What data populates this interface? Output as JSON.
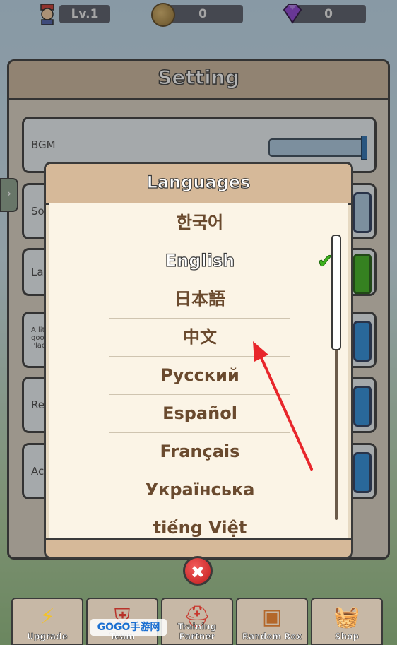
{
  "topbar": {
    "level": "Lv.1",
    "coins": "0",
    "gems": "0"
  },
  "settings": {
    "title": "Setting",
    "rows": [
      {
        "label": "BGM"
      },
      {
        "label": "So"
      },
      {
        "label": "La"
      },
      {
        "label": "A lit goo Plac"
      },
      {
        "label": "Re"
      },
      {
        "label": "Ac"
      }
    ]
  },
  "languages": {
    "title": "Languages",
    "selected": "English",
    "items": [
      "한국어",
      "English",
      "日本語",
      "中文",
      "Русский",
      "Español",
      "Français",
      "Українська",
      "tiếng Việt"
    ]
  },
  "close_button": {
    "icon": "close-icon",
    "label": "✖"
  },
  "bottom_nav": [
    {
      "label": "Upgrade",
      "icon": "lightning-icon"
    },
    {
      "label": "Team",
      "icon": "shield-icon"
    },
    {
      "label": "Training Partner",
      "icon": "helmet-icon"
    },
    {
      "label": "Random Box",
      "icon": "chest-icon"
    },
    {
      "label": "Shop",
      "icon": "basket-icon"
    }
  ],
  "watermark": {
    "text": "GOGO手游网"
  },
  "colors": {
    "accent_check": "#3db11c",
    "close_red": "#d42a2a",
    "arrow_red": "#e8262b"
  }
}
